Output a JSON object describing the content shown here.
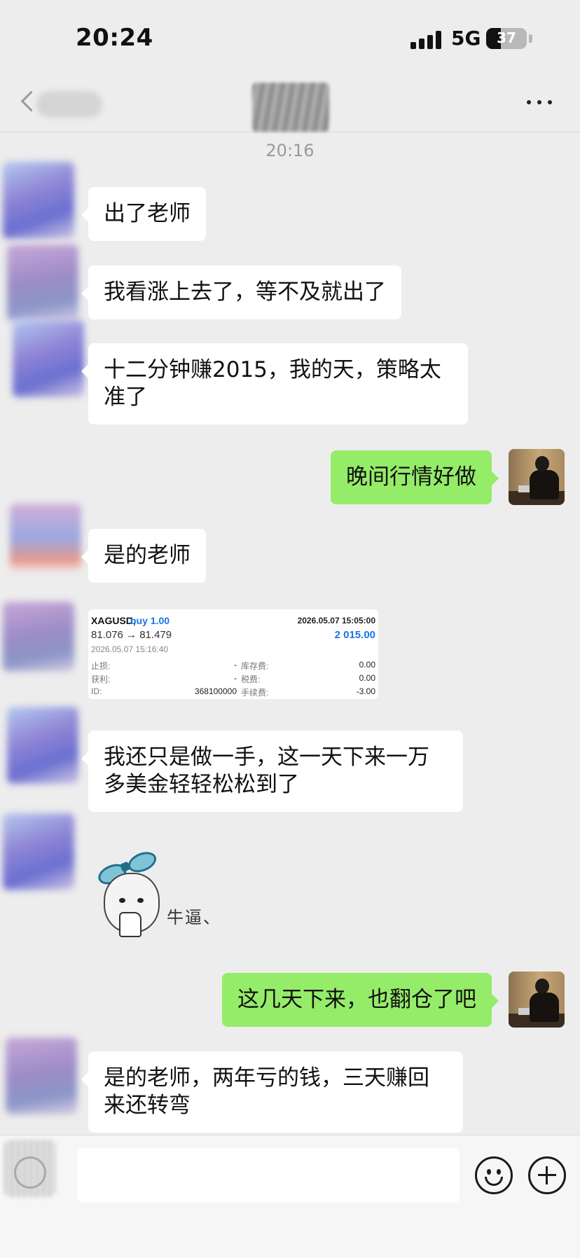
{
  "status_bar": {
    "time": "20:24",
    "network": "5G",
    "battery_level": "37",
    "battery_fraction": 0.37
  },
  "header": {
    "back_label": "",
    "title": ""
  },
  "chat": {
    "timestamp": "20:16",
    "messages": [
      {
        "side": "left",
        "text": "出了老师"
      },
      {
        "side": "left",
        "text": "我看涨上去了，等不及就出了"
      },
      {
        "side": "left",
        "text": "十二分钟赚2015，我的天，策略太准了"
      },
      {
        "side": "right",
        "text": "晚间行情好做"
      },
      {
        "side": "left",
        "text": "是的老师"
      },
      {
        "side": "left",
        "text": "我还只是做一手，这一天下来一万多美金轻轻松松到了"
      },
      {
        "side": "right",
        "text": "这几天下来，也翻仓了吧"
      },
      {
        "side": "left",
        "text": "是的老师，两年亏的钱，三天赚回来还转弯"
      }
    ],
    "trade_card": {
      "symbol": "XAGUSD,",
      "side": "buy 1.00",
      "open_time": "2026.05.07 15:05:00",
      "prices": "81.076 → 81.479",
      "profit": "2 015.00",
      "close_time": "2026.05.07 15:16:40",
      "stop_loss_label": "止损:",
      "stop_loss": "-",
      "swap_label": "库存费:",
      "swap": "0.00",
      "take_profit_label": "获利:",
      "take_profit": "-",
      "tax_label": "税费:",
      "tax": "0.00",
      "id_label": "ID:",
      "id": "368100000",
      "commission_label": "手续费:",
      "commission": "-3.00"
    },
    "sticker": {
      "text": "牛逼、"
    }
  },
  "input_bar": {
    "placeholder": ""
  }
}
